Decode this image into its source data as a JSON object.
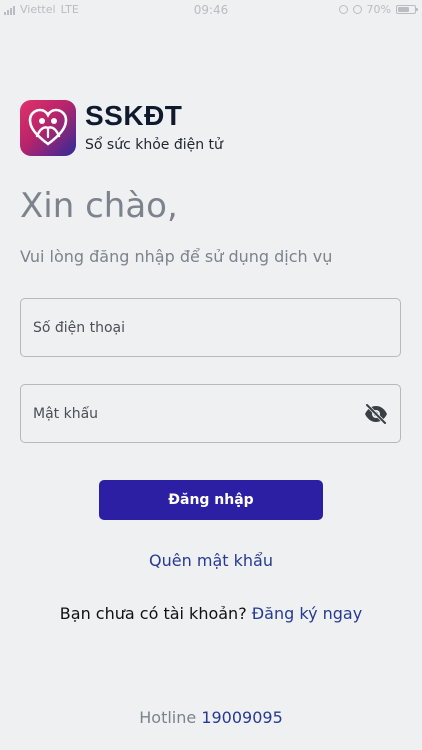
{
  "status_bar": {
    "carrier": "Viettel",
    "network": "LTE",
    "time": "09:46",
    "battery": "70%",
    "battery_level": 0.7
  },
  "app": {
    "name": "SSKĐT",
    "subtitle": "Sổ sức khỏe điện tử",
    "logo_colors": [
      "#e0326a",
      "#b8246a",
      "#2f2a9a"
    ]
  },
  "greeting": {
    "title": "Xin chào,",
    "subtitle": "Vui lòng đăng nhập để sử dụng dịch vụ"
  },
  "form": {
    "phone": {
      "placeholder": "Số điện thoại",
      "value": ""
    },
    "password": {
      "placeholder": "Mật khẩu",
      "value": "",
      "toggle_icon": "eye-off-icon"
    },
    "login_label": "Đăng nhập",
    "forgot_label": "Quên mật khẩu"
  },
  "register": {
    "prompt": "Bạn chưa có tài khoản?",
    "link": "Đăng ký ngay"
  },
  "hotline": {
    "label": "Hotline",
    "number": "19009095"
  },
  "colors": {
    "primary": "#2c1fa3",
    "link": "#273a92",
    "muted": "#7d838d",
    "background": "#eef0f1"
  }
}
